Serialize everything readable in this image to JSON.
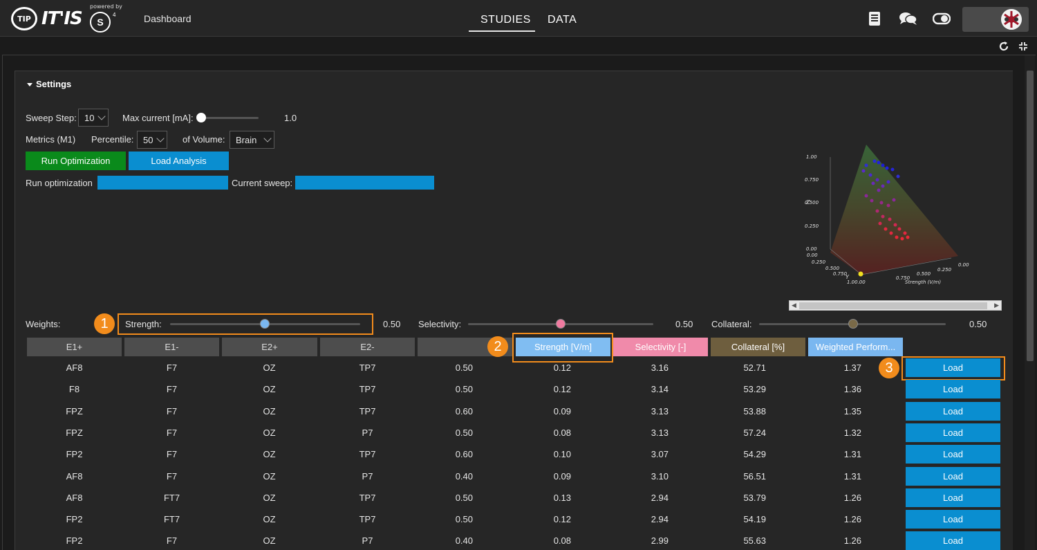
{
  "header": {
    "logo_tip": "TIP",
    "logo_itis": "IT'IS",
    "powered_by": "powered by",
    "logo_s4": "S",
    "logo_s4_sup": "4",
    "dashboard": "Dashboard",
    "tabs": [
      {
        "label": "STUDIES",
        "active": true
      },
      {
        "label": "DATA",
        "active": false
      }
    ],
    "icons": [
      "book-icon",
      "chat-icon",
      "toggle-icon"
    ],
    "accent": "#0a8ed0"
  },
  "settings": {
    "title": "Settings",
    "sweep_step_label": "Sweep Step:",
    "sweep_step_value": "10",
    "max_current_label": "Max current [mA]:",
    "max_current_value": "1.0",
    "max_current_level": 0.0,
    "metrics_label": "Metrics (M1)",
    "percentile_label": "Percentile:",
    "percentile_value": "50",
    "volume_label": "of Volume:",
    "volume_value": "Brain",
    "run_optimization_button": "Run Optimization",
    "load_analysis_button": "Load Analysis",
    "run_progress_label": "Run optimization",
    "run_progress": 1.0,
    "current_sweep_label": "Current sweep:",
    "current_sweep_progress": 1.0
  },
  "weights": {
    "label": "Weights:",
    "strength_label": "Strength:",
    "strength_value": "0.50",
    "strength_color": "#7ab7f0",
    "selectivity_label": "Selectivity:",
    "selectivity_value": "0.50",
    "selectivity_color": "#f07aa0",
    "collateral_label": "Collateral:",
    "collateral_value": "0.50",
    "collateral_color": "#7a6a48"
  },
  "callouts": [
    "1",
    "2",
    "3"
  ],
  "table": {
    "headers": [
      "E1+",
      "E1-",
      "E2+",
      "E2-",
      "",
      "Strength [V/m]",
      "Selectivity [-]",
      "Collateral [%]",
      "Weighted Perform..."
    ],
    "header_colors": {
      "strength": "#80bdf2",
      "selectivity": "#f08aaa",
      "collateral": "#6e5e3e",
      "weighted": "#7ab7f0"
    },
    "load_label": "Load",
    "rows": [
      [
        "AF8",
        "F7",
        "OZ",
        "TP7",
        "0.50",
        "0.12",
        "3.16",
        "52.71",
        "1.37"
      ],
      [
        "F8",
        "F7",
        "OZ",
        "TP7",
        "0.50",
        "0.12",
        "3.14",
        "53.29",
        "1.36"
      ],
      [
        "FPZ",
        "F7",
        "OZ",
        "TP7",
        "0.60",
        "0.09",
        "3.13",
        "53.88",
        "1.35"
      ],
      [
        "FPZ",
        "F7",
        "OZ",
        "P7",
        "0.50",
        "0.08",
        "3.13",
        "57.24",
        "1.32"
      ],
      [
        "FP2",
        "F7",
        "OZ",
        "TP7",
        "0.60",
        "0.10",
        "3.07",
        "54.29",
        "1.31"
      ],
      [
        "AF8",
        "F7",
        "OZ",
        "P7",
        "0.40",
        "0.09",
        "3.10",
        "56.51",
        "1.31"
      ],
      [
        "AF8",
        "FT7",
        "OZ",
        "TP7",
        "0.50",
        "0.13",
        "2.94",
        "53.79",
        "1.26"
      ],
      [
        "FP2",
        "FT7",
        "OZ",
        "TP7",
        "0.50",
        "0.12",
        "2.94",
        "54.19",
        "1.26"
      ],
      [
        "FP2",
        "F7",
        "OZ",
        "P7",
        "0.40",
        "0.08",
        "2.99",
        "55.63",
        "1.26"
      ]
    ]
  },
  "plot3d": {
    "z_label": "Z",
    "y_label": "Y",
    "x_label": "Strength (V/m)",
    "z_ticks": [
      "1.00",
      "0.750",
      "0.500",
      "0.250",
      "0.00"
    ],
    "y_ticks": [
      "0.00",
      "0.250",
      "0.500",
      "0.750",
      "1.00.00"
    ],
    "x_ticks": [
      "0.750",
      "0.500",
      "0.250",
      "0.00"
    ]
  }
}
